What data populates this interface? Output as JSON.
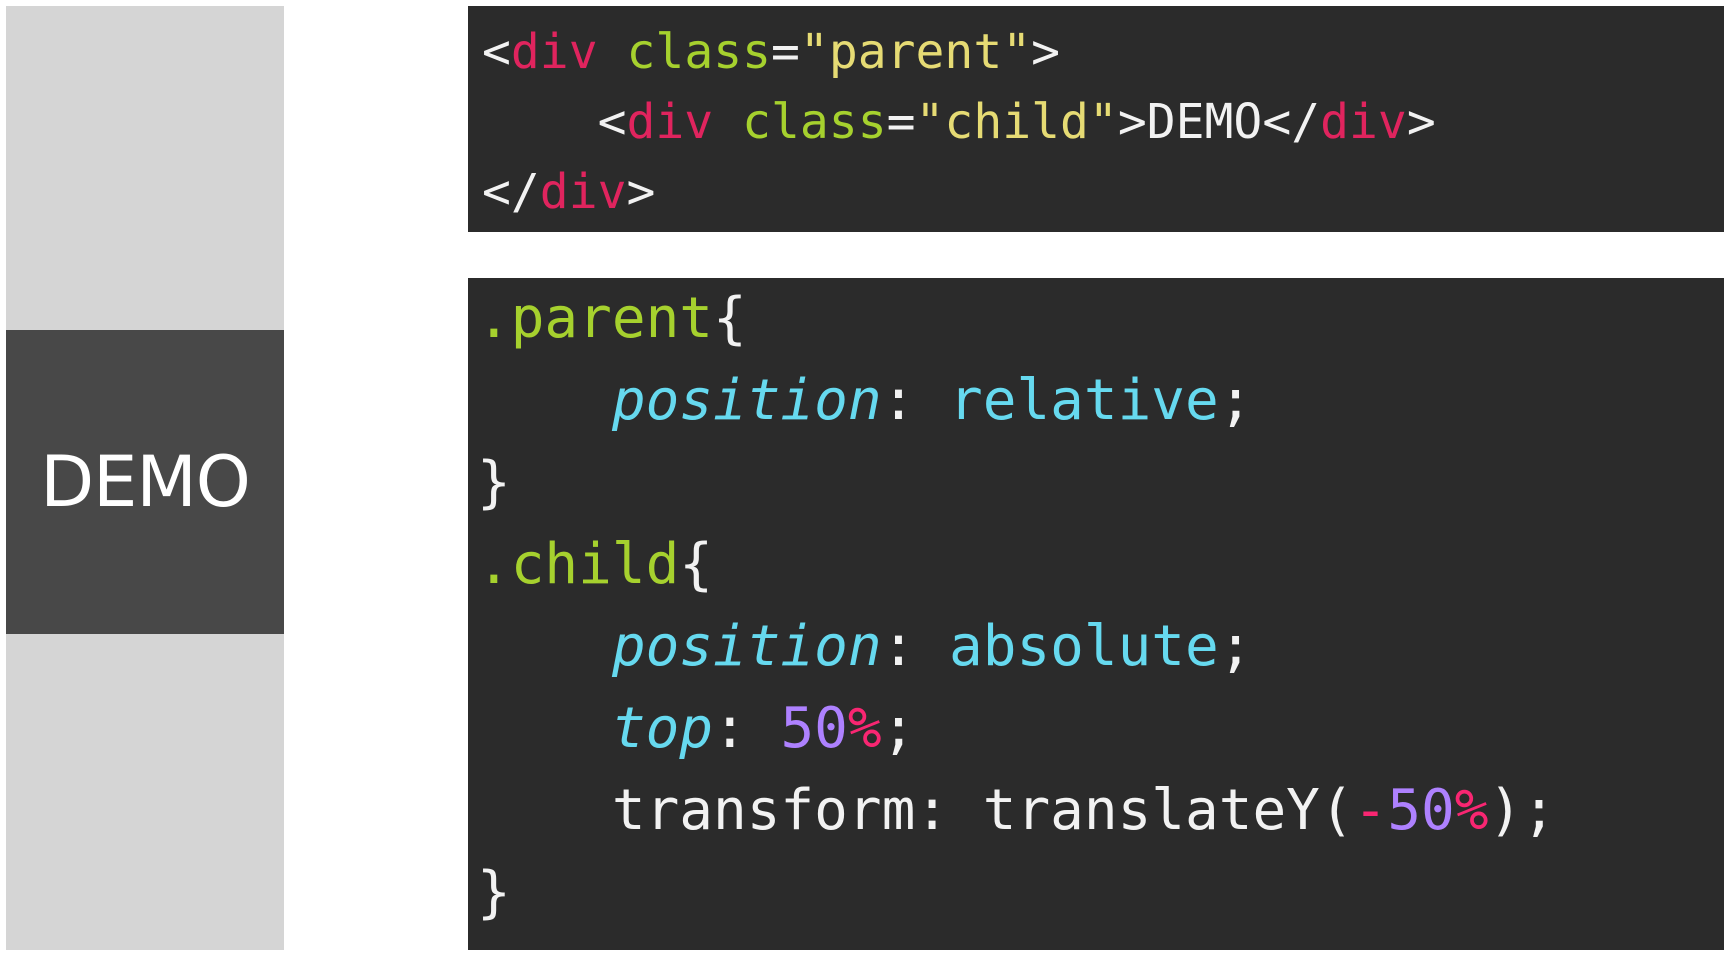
{
  "demo": {
    "label": "DEMO"
  },
  "html_code": {
    "lines": [
      [
        {
          "t": "<",
          "c": "punct"
        },
        {
          "t": "div",
          "c": "tag"
        },
        {
          "t": " ",
          "c": "text"
        },
        {
          "t": "class",
          "c": "attr"
        },
        {
          "t": "=",
          "c": "punct"
        },
        {
          "t": "\"parent\"",
          "c": "str"
        },
        {
          "t": ">",
          "c": "punct"
        }
      ],
      [
        {
          "t": "    <",
          "c": "punct"
        },
        {
          "t": "div",
          "c": "tag"
        },
        {
          "t": " ",
          "c": "text"
        },
        {
          "t": "class",
          "c": "attr"
        },
        {
          "t": "=",
          "c": "punct"
        },
        {
          "t": "\"child\"",
          "c": "str"
        },
        {
          "t": ">",
          "c": "punct"
        },
        {
          "t": "DEMO",
          "c": "text"
        },
        {
          "t": "</",
          "c": "punct"
        },
        {
          "t": "div",
          "c": "tag"
        },
        {
          "t": ">",
          "c": "punct"
        }
      ],
      [
        {
          "t": "</",
          "c": "punct"
        },
        {
          "t": "div",
          "c": "tag"
        },
        {
          "t": ">",
          "c": "punct"
        }
      ]
    ]
  },
  "css_code": {
    "lines": [
      [
        {
          "t": ".parent",
          "c": "sel"
        },
        {
          "t": "{",
          "c": "punct"
        }
      ],
      [
        {
          "t": "    ",
          "c": "text"
        },
        {
          "t": "position",
          "c": "prop"
        },
        {
          "t": ": ",
          "c": "punct"
        },
        {
          "t": "relative",
          "c": "val"
        },
        {
          "t": ";",
          "c": "punct"
        }
      ],
      [
        {
          "t": "}",
          "c": "punct"
        }
      ],
      [
        {
          "t": ".child",
          "c": "sel"
        },
        {
          "t": "{",
          "c": "punct"
        }
      ],
      [
        {
          "t": "    ",
          "c": "text"
        },
        {
          "t": "position",
          "c": "prop"
        },
        {
          "t": ": ",
          "c": "punct"
        },
        {
          "t": "absolute",
          "c": "val"
        },
        {
          "t": ";",
          "c": "punct"
        }
      ],
      [
        {
          "t": "    ",
          "c": "text"
        },
        {
          "t": "top",
          "c": "prop"
        },
        {
          "t": ": ",
          "c": "punct"
        },
        {
          "t": "50",
          "c": "num"
        },
        {
          "t": "%",
          "c": "unit"
        },
        {
          "t": ";",
          "c": "punct"
        }
      ],
      [
        {
          "t": "    transform: translateY(",
          "c": "text"
        },
        {
          "t": "-",
          "c": "unit"
        },
        {
          "t": "50",
          "c": "num"
        },
        {
          "t": "%",
          "c": "unit"
        },
        {
          "t": ");",
          "c": "punct"
        }
      ],
      [
        {
          "t": "}",
          "c": "punct"
        }
      ]
    ]
  },
  "colors": {
    "code_background": "#2b2b2b",
    "demo_parent": "#d5d5d5",
    "demo_child": "#484848",
    "tag": "#e0245e",
    "attribute": "#a6d12e",
    "string": "#e6db74",
    "selector": "#a6d12e",
    "property": "#66d9ef",
    "value": "#66d9ef",
    "number": "#ae81ff",
    "unit": "#f92672"
  }
}
